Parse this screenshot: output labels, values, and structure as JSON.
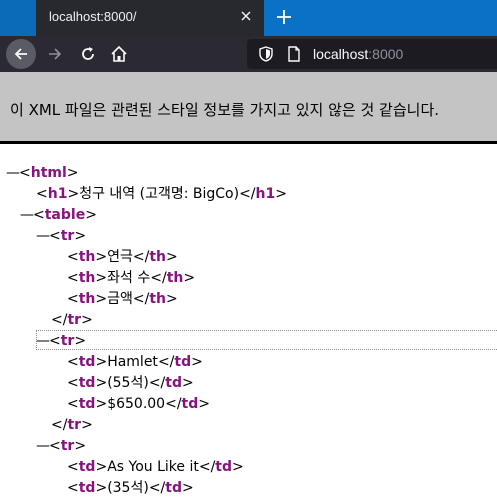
{
  "browser": {
    "tab_title": "localhost:8000/",
    "url_host": "localhost",
    "url_port": ":8000"
  },
  "banner": {
    "message": "이 XML 파일은 관련된 스타일 정보를 가지고 있지 않은 것 같습니다."
  },
  "xml": {
    "root_tag": "html",
    "h1_tag": "h1",
    "h1_text": "청구 내역 (고객명: BigCo)",
    "table_tag": "table",
    "tr_tag": "tr",
    "th_tag": "th",
    "td_tag": "td",
    "headers": [
      "연극",
      "좌석 수",
      "금액"
    ],
    "rows": [
      [
        "Hamlet",
        "(55석)",
        "$650.00"
      ],
      [
        "As You Like it",
        "(35석)"
      ]
    ],
    "collapse_glyph": "—",
    "open_lt": "<",
    "close_lt": "</",
    "gt": ">"
  },
  "colors": {
    "tab_strip": "#0a72c6",
    "toolbar": "#2b2a33",
    "banner": "#c4c4c4",
    "tag": "#881280"
  },
  "icons": [
    "close-icon",
    "plus-icon",
    "back-arrow-icon",
    "forward-arrow-icon",
    "reload-icon",
    "home-icon",
    "shield-icon",
    "page-icon"
  ]
}
